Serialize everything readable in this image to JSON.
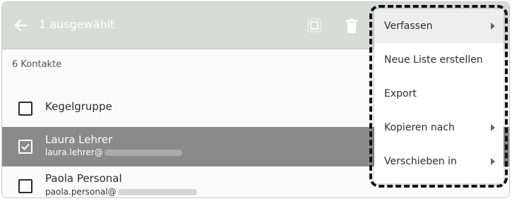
{
  "toolbar": {
    "back_icon": "arrow-left-icon",
    "selection_label": "1 ausgewählt",
    "select_all_icon": "select-all-icon",
    "delete_icon": "trash-icon"
  },
  "list": {
    "count_label": "6 Kontakte",
    "contacts": [
      {
        "name": "Kegelgruppe",
        "email_prefix": "",
        "checked": false
      },
      {
        "name": "Laura Lehrer",
        "email_prefix": "laura.lehrer@",
        "checked": true
      },
      {
        "name": "Paola Personal",
        "email_prefix": "paola.personal@",
        "checked": false
      }
    ]
  },
  "context_menu": {
    "items": [
      {
        "label": "Verfassen",
        "has_submenu": true
      },
      {
        "label": "Neue Liste erstellen",
        "has_submenu": false
      },
      {
        "label": "Export",
        "has_submenu": false
      },
      {
        "label": "Kopieren nach",
        "has_submenu": true
      },
      {
        "label": "Verschieben in",
        "has_submenu": true
      }
    ]
  },
  "colors": {
    "toolbar_bg": "#d7dcd8",
    "selected_row_bg": "#8a8a8a",
    "menu_bg": "#ffffff",
    "highlight_outline": "#111111"
  }
}
